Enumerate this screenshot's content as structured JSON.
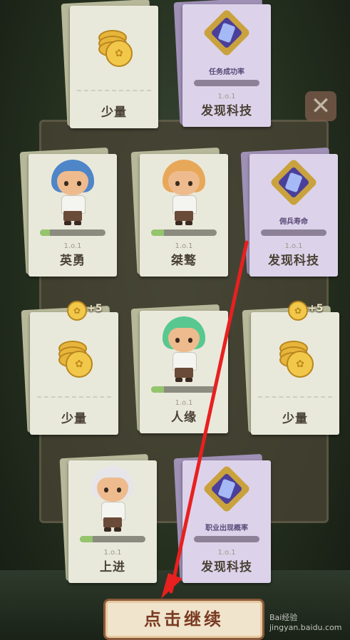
{
  "cards": [
    {
      "id": "c1",
      "kind": "coin",
      "name": "少量"
    },
    {
      "id": "c2",
      "kind": "tech",
      "name": "发现科技",
      "tech_label": "任务成功率",
      "lv": "1.o.1"
    },
    {
      "id": "c3",
      "kind": "hero",
      "name": "英勇",
      "lv": "1.o.1",
      "progress": 0.15,
      "hair": "#4e86c8"
    },
    {
      "id": "c4",
      "kind": "hero",
      "name": "桀骜",
      "lv": "1.o.1",
      "progress": 0.2,
      "hair": "#e8a85a"
    },
    {
      "id": "c5",
      "kind": "tech",
      "name": "发现科技",
      "tech_label": "佣兵寿命",
      "lv": "1.o.1"
    },
    {
      "id": "c6",
      "kind": "coin",
      "name": "少量",
      "bonus": "+5"
    },
    {
      "id": "c7",
      "kind": "hero",
      "name": "人缘",
      "lv": "1.o.1",
      "progress": 0.2,
      "hair": "#58c890"
    },
    {
      "id": "c8",
      "kind": "coin",
      "name": "少量",
      "bonus": "+5"
    },
    {
      "id": "c9",
      "kind": "hero",
      "name": "上进",
      "lv": "1.o.1",
      "progress": 0.2,
      "hair": "#e6e6ea"
    },
    {
      "id": "c10",
      "kind": "tech",
      "name": "发现科技",
      "tech_label": "职业出现概率",
      "lv": "1.o.1"
    }
  ],
  "continue_label": "点击继续",
  "watermark": "Bai经验 jingyan.baidu.com",
  "colors": {
    "arrow": "#e82020",
    "coin": "#f1c84a",
    "tech_card": "#dcd3ea",
    "plain_card": "#e9e9db"
  }
}
